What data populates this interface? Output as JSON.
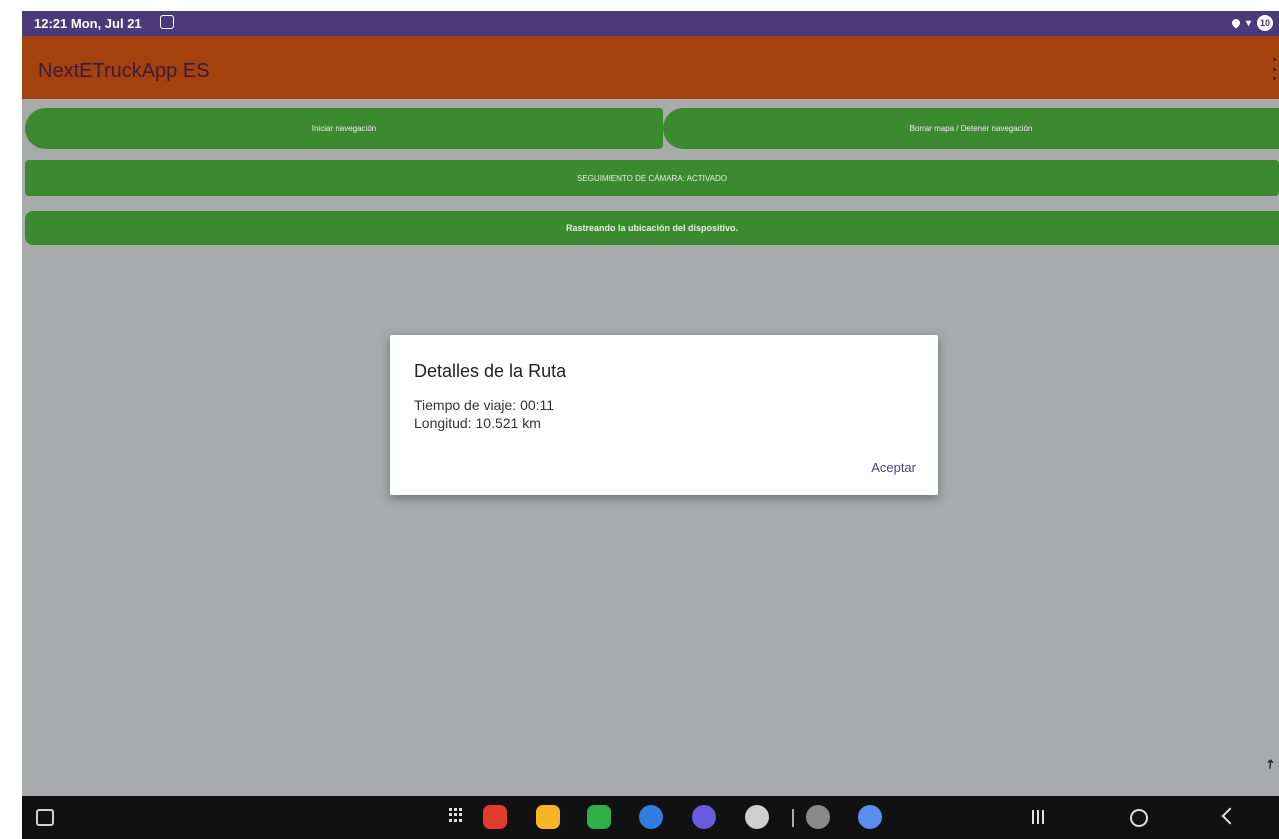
{
  "status_bar": {
    "time": "12:21  Mon, Jul 21",
    "notification_icon": "app-notification-icon",
    "battery": "10"
  },
  "app_bar": {
    "title": "NextETruckApp ES",
    "menu_icon": "overflow-menu-icon"
  },
  "actions": {
    "start_navigation": "Iniciar navegación",
    "clear_map": "Borrar mapa / Detener navegación",
    "camera_tracking": "SEGUIMIENTO DE CÁMARA: ACTIVADO",
    "location_tracking": "Rastreando la ubicación del dispositivo."
  },
  "dialog": {
    "title": "Detalles de la Ruta",
    "travel_time": "Tiempo de viaje: 00:11",
    "length": "Longitud: 10.521 km",
    "accept": "Aceptar"
  },
  "nav_bar": {
    "dock_apps": [
      {
        "name": "notes-app-icon",
        "color": "#e23b2e"
      },
      {
        "name": "files-app-icon",
        "color": "#f4b625"
      },
      {
        "name": "phone-app-icon",
        "color": "#2fae4a"
      },
      {
        "name": "messages-app-icon",
        "color": "#2f7de1"
      },
      {
        "name": "internet-app-icon",
        "color": "#6a5ae0"
      },
      {
        "name": "camera-app-icon",
        "color": "#cfcfcf"
      },
      {
        "name": "settings-app-icon",
        "color": "#8a8a8a"
      },
      {
        "name": "assistant-app-icon",
        "color": "#5b8cf0"
      }
    ]
  },
  "colors": {
    "status_bar": "#4b3a7a",
    "app_bar": "#a3420f",
    "button_green": "#3c8a2f",
    "content_background": "#a8aaab",
    "accent": "#4a3f8f"
  }
}
